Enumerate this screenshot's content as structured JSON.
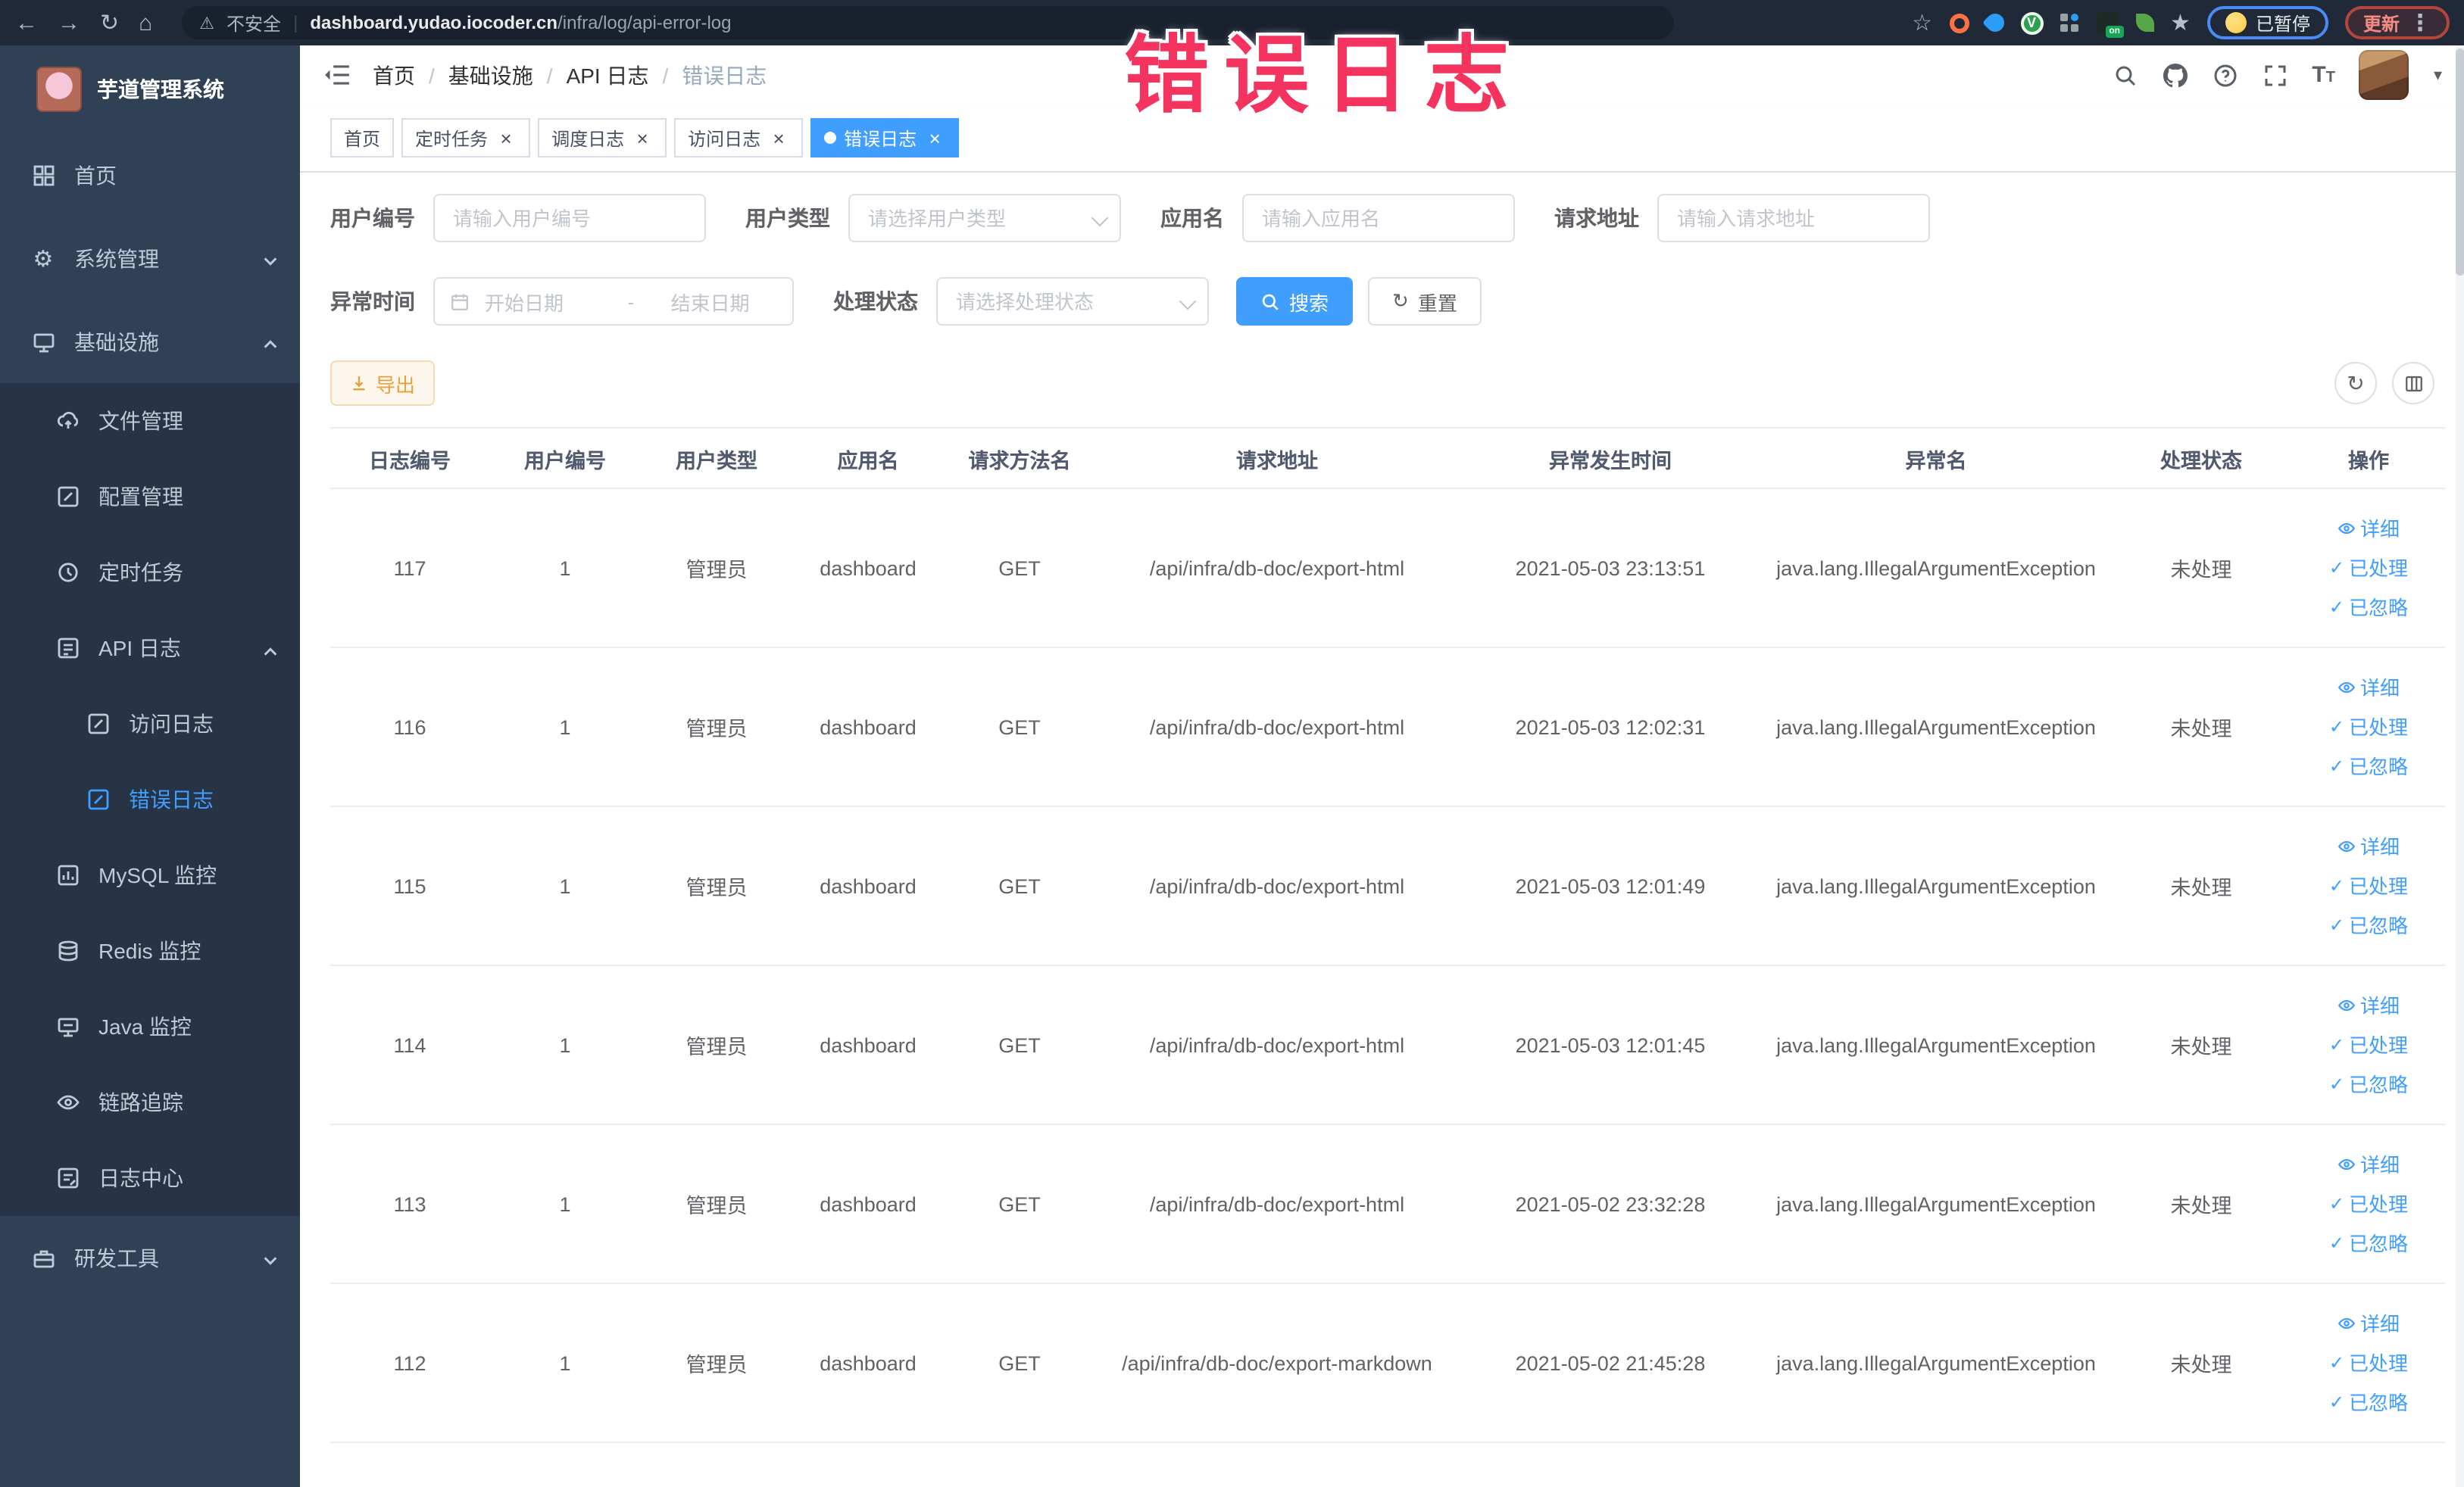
{
  "annotation": {
    "text": "错误日志",
    "color": "#f4335e"
  },
  "colors": {
    "accent": "#409eff",
    "warning": "#e6a23c",
    "annotation": "#f4335e",
    "sidebar_bg": "#304156",
    "sidebar_submenu_bg": "#263445",
    "sidebar_text": "#bfcbd9"
  },
  "icons": {
    "back": "←",
    "forward": "→",
    "reload": "↻",
    "home": "⌂",
    "warning": "⚠",
    "pipe": "|",
    "star_outline": "☆",
    "star_filled": "★",
    "more": "⋮",
    "caret": "▾",
    "check": "✓",
    "close": "×",
    "v_badge": "V",
    "on_badge": "on"
  },
  "browser": {
    "security_label": "不安全",
    "url_domain": "dashboard.yudao.iocoder.cn",
    "url_path": "/infra/log/api-error-log",
    "profile_status": "已暂停",
    "update_label": "更新"
  },
  "sidebar": {
    "logo_title": "芋道管理系统",
    "items": [
      {
        "label": "首页"
      },
      {
        "label": "系统管理"
      },
      {
        "label": "基础设施"
      },
      {
        "label": "文件管理"
      },
      {
        "label": "配置管理"
      },
      {
        "label": "定时任务"
      },
      {
        "label": "API 日志"
      },
      {
        "label": "访问日志"
      },
      {
        "label": "错误日志",
        "active": true
      },
      {
        "label": "MySQL 监控"
      },
      {
        "label": "Redis 监控"
      },
      {
        "label": "Java 监控"
      },
      {
        "label": "链路追踪"
      },
      {
        "label": "日志中心"
      },
      {
        "label": "研发工具"
      }
    ]
  },
  "header": {
    "breadcrumb": [
      "首页",
      "基础设施",
      "API 日志",
      "错误日志"
    ],
    "separator": "/"
  },
  "tags": [
    {
      "label": "首页"
    },
    {
      "label": "定时任务"
    },
    {
      "label": "调度日志"
    },
    {
      "label": "访问日志"
    },
    {
      "label": "错误日志",
      "active": true
    }
  ],
  "filters": {
    "user_id": {
      "label": "用户编号",
      "placeholder": "请输入用户编号"
    },
    "user_type": {
      "label": "用户类型",
      "placeholder": "请选择用户类型"
    },
    "app_name": {
      "label": "应用名",
      "placeholder": "请输入应用名"
    },
    "request_url": {
      "label": "请求地址",
      "placeholder": "请输入请求地址"
    },
    "exception_time": {
      "label": "异常时间",
      "start_placeholder": "开始日期",
      "separator": "-",
      "end_placeholder": "结束日期"
    },
    "process_status": {
      "label": "处理状态",
      "placeholder": "请选择处理状态"
    },
    "search_label": "搜索",
    "reset_label": "重置"
  },
  "toolbar": {
    "export_label": "导出"
  },
  "table": {
    "columns": [
      "日志编号",
      "用户编号",
      "用户类型",
      "应用名",
      "请求方法名",
      "请求地址",
      "异常发生时间",
      "异常名",
      "处理状态",
      "操作"
    ],
    "actions": [
      "详细",
      "已处理",
      "已忽略"
    ],
    "rows": [
      {
        "id": "117",
        "user_id": "1",
        "user_type": "管理员",
        "app": "dashboard",
        "method": "GET",
        "url": "/api/infra/db-doc/export-html",
        "time": "2021-05-03 23:13:51",
        "exception": "java.lang.IllegalArgumentException",
        "status": "未处理"
      },
      {
        "id": "116",
        "user_id": "1",
        "user_type": "管理员",
        "app": "dashboard",
        "method": "GET",
        "url": "/api/infra/db-doc/export-html",
        "time": "2021-05-03 12:02:31",
        "exception": "java.lang.IllegalArgumentException",
        "status": "未处理"
      },
      {
        "id": "115",
        "user_id": "1",
        "user_type": "管理员",
        "app": "dashboard",
        "method": "GET",
        "url": "/api/infra/db-doc/export-html",
        "time": "2021-05-03 12:01:49",
        "exception": "java.lang.IllegalArgumentException",
        "status": "未处理"
      },
      {
        "id": "114",
        "user_id": "1",
        "user_type": "管理员",
        "app": "dashboard",
        "method": "GET",
        "url": "/api/infra/db-doc/export-html",
        "time": "2021-05-03 12:01:45",
        "exception": "java.lang.IllegalArgumentException",
        "status": "未处理"
      },
      {
        "id": "113",
        "user_id": "1",
        "user_type": "管理员",
        "app": "dashboard",
        "method": "GET",
        "url": "/api/infra/db-doc/export-html",
        "time": "2021-05-02 23:32:28",
        "exception": "java.lang.IllegalArgumentException",
        "status": "未处理"
      },
      {
        "id": "112",
        "user_id": "1",
        "user_type": "管理员",
        "app": "dashboard",
        "method": "GET",
        "url": "/api/infra/db-doc/export-markdown",
        "time": "2021-05-02 21:45:28",
        "exception": "java.lang.IllegalArgumentException",
        "status": "未处理"
      }
    ]
  }
}
